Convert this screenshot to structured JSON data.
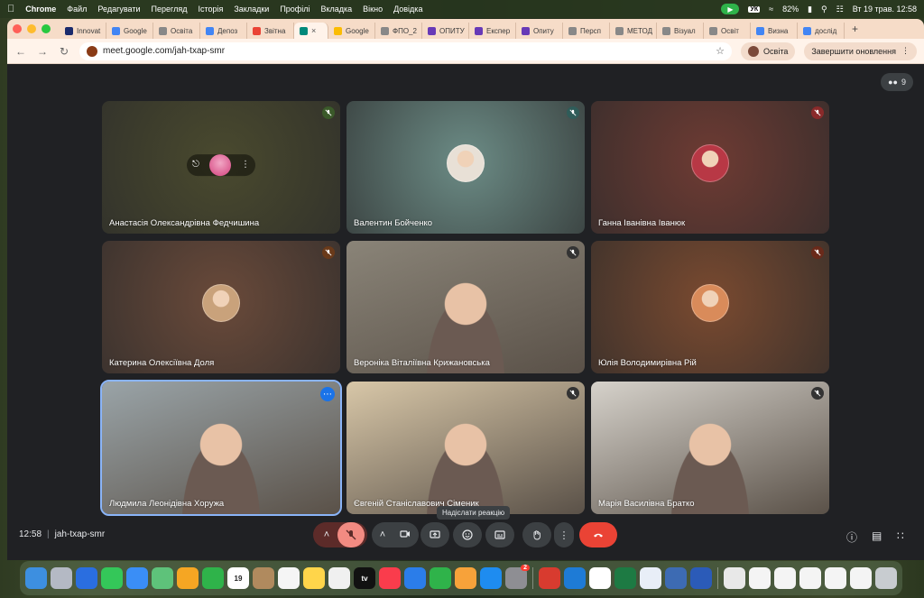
{
  "menubar": {
    "app": "Chrome",
    "items": [
      "Файл",
      "Редагувати",
      "Перегляд",
      "Історія",
      "Закладки",
      "Профілі",
      "Вкладка",
      "Вікно",
      "Довідка"
    ],
    "battery": "82%",
    "datetime": "Вт 19 трав.  12:58",
    "vk_badge": "УК"
  },
  "tabs": [
    {
      "label": "Innovat",
      "color": "#1a2a6c"
    },
    {
      "label": "Google",
      "color": "#4285f4"
    },
    {
      "label": "Освіта",
      "color": "#888888"
    },
    {
      "label": "Депоз",
      "color": "#4285f4"
    },
    {
      "label": "Звітна",
      "color": "#ea4335"
    },
    {
      "label": "",
      "color": "#00897b",
      "active": true
    },
    {
      "label": "Google",
      "color": "#fbbc04"
    },
    {
      "label": "ФПО_2",
      "color": "#888888"
    },
    {
      "label": "ОПИТУ",
      "color": "#673ab7"
    },
    {
      "label": "Експер",
      "color": "#673ab7"
    },
    {
      "label": "Опиту",
      "color": "#673ab7"
    },
    {
      "label": "Персп",
      "color": "#888888"
    },
    {
      "label": "МЕТОД",
      "color": "#888888"
    },
    {
      "label": "Візуал",
      "color": "#888888"
    },
    {
      "label": "Освіт",
      "color": "#888888"
    },
    {
      "label": "Визна",
      "color": "#4285f4"
    },
    {
      "label": "дослід",
      "color": "#4285f4"
    }
  ],
  "toolbar": {
    "url": "meet.google.com/jah-txap-smr",
    "profile": "Освіта",
    "update": "Завершити оновлення"
  },
  "meet": {
    "people_count": "9",
    "participants": [
      {
        "name": "Анастасія Олександрівна Федчишина",
        "bg": "#4a4a2e",
        "avatar": "#d4417d",
        "mic": "#3b5a2a",
        "pinned": true
      },
      {
        "name": "Валентин Бойченко",
        "bg": "#6c8c86",
        "avatar": "#e8e0d6",
        "mic": "#2f5c59"
      },
      {
        "name": "Ганна Іванівна Іванюк",
        "bg": "#6e3b33",
        "avatar": "#b83845",
        "mic": "#8a2a2a"
      },
      {
        "name": "Катерина Олексіївна Доля",
        "bg": "#6a4a3a",
        "avatar": "#c9a27b",
        "mic": "#6a3a1a"
      },
      {
        "name": "Вероніка Віталіївна Крижановська",
        "bg": "#8a8478",
        "avatar": "",
        "mic": "#333333",
        "video": true
      },
      {
        "name": "Юлія Володимирівна Рій",
        "bg": "#7a4a30",
        "avatar": "#d98b5a",
        "mic": "#6a2a1a"
      },
      {
        "name": "Людмила Леонідівна Хоружа",
        "bg": "#9aa4a8",
        "avatar": "",
        "mic": "",
        "video": true,
        "active": true
      },
      {
        "name": "Євгеній Станіславович Сіменик",
        "bg": "#d8c7a8",
        "avatar": "",
        "mic": "#333333",
        "video": true
      },
      {
        "name": "Марія Василівна Братко",
        "bg": "#d6d2cb",
        "avatar": "",
        "mic": "#333333",
        "video": true
      }
    ]
  },
  "controls": {
    "time": "12:58",
    "meeting_code": "jah-txap-smr",
    "tooltip": "Надіслати реакцію"
  },
  "dock": {
    "calendar_day": "19",
    "appstore_badge": "2",
    "tv_label": "tv"
  }
}
